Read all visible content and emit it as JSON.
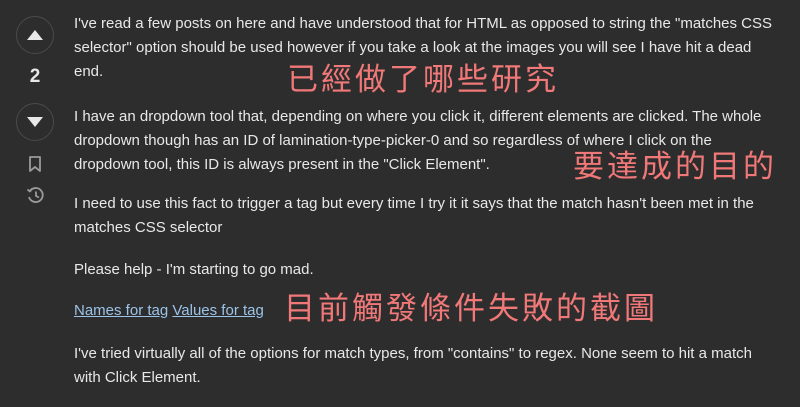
{
  "vote": {
    "count": "2",
    "up_icon": "triangle-up-icon",
    "down_icon": "triangle-down-icon",
    "bookmark_icon": "bookmark-icon",
    "history_icon": "history-icon"
  },
  "post": {
    "p1": "I've read a few posts on here and have understood that for HTML as opposed to string the \"matches CSS selector\" option should be used however if you take a look at the images you will see I have hit a dead end.",
    "p2": "I have an dropdown tool that, depending on where you click it, different elements are clicked. The whole dropdown though has an ID of lamination-type-picker-0 and so regardless of where I click on the dropdown tool, this ID is always present in the \"Click Element\".",
    "p3": "I need to use this fact to trigger a tag but every time I try it it says that the match hasn't been met in the matches CSS selector",
    "p4": "Please help - I'm starting to go mad.",
    "link1": "Names for tag",
    "link2": "Values for tag",
    "p6": "I've tried virtually all of the options for match types, from \"contains\" to regex. None seem to hit a match with Click Element."
  },
  "annotations": {
    "a1": "已經做了哪些研究",
    "a2": "要達成的目的",
    "a3": "目前觸發條件失敗的截圖"
  },
  "colors": {
    "background": "#2d2d2d",
    "text": "#e8e8e8",
    "link": "#9cc3e8",
    "annotation": "#f07878",
    "icon": "#9a9a9a"
  }
}
